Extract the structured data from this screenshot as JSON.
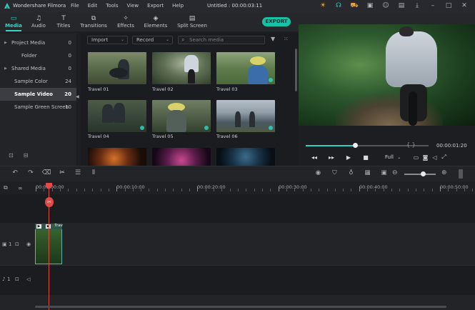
{
  "app": {
    "name": "Wondershare Filmora",
    "document_title": "Untitled : 00:00:03:11",
    "menu": [
      "File",
      "Edit",
      "Tools",
      "View",
      "Export",
      "Help"
    ],
    "titlebar_icons": [
      "bulb-icon",
      "headset-icon",
      "cart-icon",
      "gift-icon",
      "user-icon",
      "save-icon",
      "download-icon",
      "minimize-icon",
      "maximize-icon",
      "close-icon"
    ]
  },
  "nav": {
    "tabs": [
      {
        "label": "Media",
        "icon": "folder-icon",
        "active": true
      },
      {
        "label": "Audio",
        "icon": "music-note-icon",
        "active": false
      },
      {
        "label": "Titles",
        "icon": "text-t-icon",
        "active": false
      },
      {
        "label": "Transitions",
        "icon": "transition-icon",
        "active": false
      },
      {
        "label": "Effects",
        "icon": "effects-icon",
        "active": false
      },
      {
        "label": "Elements",
        "icon": "elements-icon",
        "active": false
      },
      {
        "label": "Split Screen",
        "icon": "split-screen-icon",
        "active": false
      }
    ],
    "export_label": "EXPORT"
  },
  "tree": {
    "items": [
      {
        "label": "Project Media",
        "count": "0",
        "expandable": true
      },
      {
        "label": "Folder",
        "count": "0",
        "expandable": false
      },
      {
        "label": "Shared Media",
        "count": "0",
        "expandable": true
      },
      {
        "label": "Sample Color",
        "count": "24",
        "expandable": false
      },
      {
        "label": "Sample Video",
        "count": "20",
        "expandable": false,
        "selected": true
      },
      {
        "label": "Sample Green Screen",
        "count": "10",
        "expandable": false
      }
    ]
  },
  "media": {
    "import_label": "Import",
    "record_label": "Record",
    "search_placeholder": "Search media",
    "items": [
      {
        "label": "Travel 01"
      },
      {
        "label": "Travel 02"
      },
      {
        "label": "Travel 03"
      },
      {
        "label": "Travel 04"
      },
      {
        "label": "Travel 05"
      },
      {
        "label": "Travel 06"
      },
      {
        "label": ""
      },
      {
        "label": ""
      },
      {
        "label": ""
      }
    ]
  },
  "preview": {
    "timecode": "00:00:01:20",
    "progress": 0.4,
    "quality": "Full",
    "brackets": "{    }"
  },
  "timeline": {
    "ruler": [
      "00:00:00:00",
      "00:00:10:00",
      "00:00:20:00",
      "00:00:30:00",
      "00:00:40:00",
      "00:00:50:00"
    ],
    "zoom_level": 0.6,
    "video_track_label": "1",
    "audio_track_label": "1",
    "clip_title": "Trav"
  },
  "colors": {
    "accent": "#2fd1c0",
    "playhead": "#e24a4a",
    "export_button": "#17c1a7"
  }
}
